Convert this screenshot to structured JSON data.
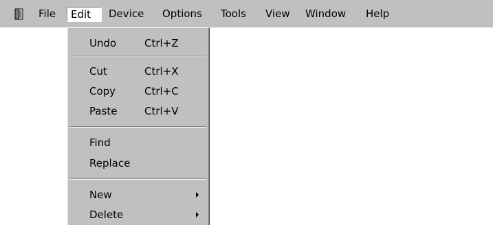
{
  "app": {
    "icon": "book-icon"
  },
  "menubar": {
    "items": [
      {
        "label": "File"
      },
      {
        "label": "Edit"
      },
      {
        "label": "Device"
      },
      {
        "label": "Options"
      },
      {
        "label": "Tools"
      },
      {
        "label": "View"
      },
      {
        "label": "Window"
      },
      {
        "label": "Help"
      }
    ],
    "active": "Edit"
  },
  "edit_menu": {
    "items": [
      {
        "label": "Undo",
        "shortcut": "Ctrl+Z"
      },
      {
        "label": "Cut",
        "shortcut": "Ctrl+X"
      },
      {
        "label": "Copy",
        "shortcut": "Ctrl+C"
      },
      {
        "label": "Paste",
        "shortcut": "Ctrl+V"
      },
      {
        "label": "Find"
      },
      {
        "label": "Replace"
      },
      {
        "label": "New",
        "submenu_icon": "submenu-arrow-icon"
      },
      {
        "label": "Delete",
        "submenu_icon": "submenu-arrow-icon"
      }
    ]
  },
  "colors": {
    "menu_background": "#c0c0c0",
    "active_menu_background": "#ffffff",
    "separator_dark": "#808080",
    "separator_light": "#ffffff"
  }
}
